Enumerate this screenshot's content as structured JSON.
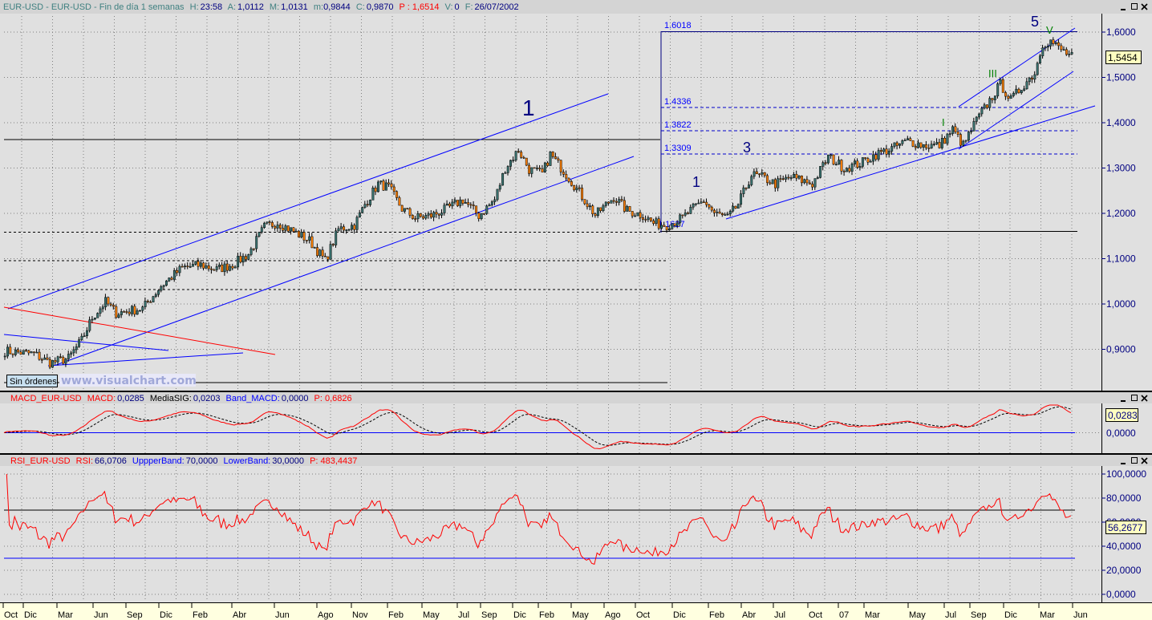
{
  "main_header": {
    "symbol": "EUR-USD - EUR-USD - Fin de día 1 semanas",
    "h_label": "H:",
    "h": "23:58",
    "a_label": "A:",
    "a": "1,0112",
    "m_label": "M:",
    "m": "1,0131",
    "min_label": "m:",
    "min": "0,9844",
    "c_label": "C:",
    "c": "0,9870",
    "p": "P : 1,6514",
    "v_label": "V:",
    "v": "0",
    "f_label": "F:",
    "f": "26/07/2002"
  },
  "macd_header": {
    "name": "MACD_EUR-USD",
    "macd_label": "MACD:",
    "macd": "0,0285",
    "sig_label": "MediaSIG:",
    "sig": "0,0203",
    "band_label": "Band_MACD:",
    "band": "0,0000",
    "p": "P: 0,6826"
  },
  "rsi_header": {
    "name": "RSI_EUR-USD",
    "rsi_label": "RSI:",
    "rsi": "66,0706",
    "upper_label": "UppperBand:",
    "upper": "70,0000",
    "lower_label": "LowerBand:",
    "lower": "30,0000",
    "p": "P: 483,4437"
  },
  "price_axis": [
    "1,6000",
    "1,5000",
    "1,4000",
    "1,3000",
    "1,2000",
    "1,1000",
    "1,0000",
    "0,9000"
  ],
  "last_price": "1,5454",
  "macd_axis": [
    "0,0000"
  ],
  "macd_last": "0,0283",
  "rsi_axis": [
    "100,0000",
    "80,0000",
    "60,0000",
    "40,0000",
    "20,0000",
    "0,0000"
  ],
  "rsi_last": "56,2677",
  "date_labels": [
    "Oct",
    "Dic",
    "Mar",
    "Jun",
    "Sep",
    "Dic",
    "Feb",
    "Abr",
    "Jun",
    "Ago",
    "Nov",
    "Feb",
    "May",
    "Jul",
    "Sep",
    "Dic",
    "Feb",
    "May",
    "Ago",
    "Oct",
    "Dic",
    "Feb",
    "Abr",
    "Jul",
    "Oct",
    "07",
    "Mar",
    "May",
    "Jul",
    "Sep",
    "Dic",
    "Mar",
    "Jun"
  ],
  "fib_levels": [
    "1.6018",
    "1.4336",
    "1.3822",
    "1.3309",
    "1.1627"
  ],
  "wave_labels": {
    "w1_big": "1",
    "w1": "1",
    "w3": "3",
    "w5": "5",
    "wI": "I",
    "wIII": "III",
    "wV": "V"
  },
  "orders_label": "Sin órdenes",
  "watermark": "www.visualchart.com",
  "colors": {
    "bull": "#3a7370",
    "bear": "#ff8000",
    "macd": "#ff0000",
    "signal": "#000000",
    "rsi": "#ff0000",
    "trend": "#0000ff"
  },
  "chart_data": {
    "type": "candlestick",
    "title": "EUR-USD weekly",
    "x_unit": "week index",
    "ylim": [
      0.85,
      1.62
    ],
    "close_anchors": [
      [
        0,
        0.896
      ],
      [
        11,
        0.89
      ],
      [
        17,
        0.87
      ],
      [
        24,
        0.88
      ],
      [
        29,
        0.92
      ],
      [
        33,
        0.97
      ],
      [
        38,
        1.005
      ],
      [
        42,
        0.98
      ],
      [
        52,
        0.99
      ],
      [
        59,
        1.04
      ],
      [
        67,
        1.08
      ],
      [
        74,
        1.086
      ],
      [
        80,
        1.076
      ],
      [
        86,
        1.087
      ],
      [
        92,
        1.11
      ],
      [
        98,
        1.17
      ],
      [
        103,
        1.18
      ],
      [
        109,
        1.16
      ],
      [
        115,
        1.14
      ],
      [
        121,
        1.095
      ],
      [
        126,
        1.165
      ],
      [
        132,
        1.174
      ],
      [
        136,
        1.22
      ],
      [
        141,
        1.265
      ],
      [
        145,
        1.257
      ],
      [
        150,
        1.21
      ],
      [
        155,
        1.19
      ],
      [
        161,
        1.195
      ],
      [
        167,
        1.21
      ],
      [
        173,
        1.23
      ],
      [
        179,
        1.195
      ],
      [
        185,
        1.23
      ],
      [
        189,
        1.3
      ],
      [
        194,
        1.34
      ],
      [
        198,
        1.297
      ],
      [
        203,
        1.287
      ],
      [
        206,
        1.33
      ],
      [
        212,
        1.287
      ],
      [
        217,
        1.246
      ],
      [
        223,
        1.196
      ],
      [
        230,
        1.236
      ],
      [
        235,
        1.206
      ],
      [
        241,
        1.196
      ],
      [
        245,
        1.178
      ],
      [
        250,
        1.174
      ],
      [
        256,
        1.19
      ],
      [
        259,
        1.206
      ],
      [
        264,
        1.228
      ],
      [
        268,
        1.2
      ],
      [
        273,
        1.19
      ],
      [
        277,
        1.22
      ],
      [
        282,
        1.285
      ],
      [
        286,
        1.28
      ],
      [
        291,
        1.265
      ],
      [
        297,
        1.28
      ],
      [
        305,
        1.265
      ],
      [
        311,
        1.325
      ],
      [
        317,
        1.3
      ],
      [
        323,
        1.31
      ],
      [
        329,
        1.33
      ],
      [
        335,
        1.343
      ],
      [
        341,
        1.36
      ],
      [
        347,
        1.35
      ],
      [
        353,
        1.35
      ],
      [
        358,
        1.385
      ],
      [
        362,
        1.35
      ],
      [
        367,
        1.406
      ],
      [
        371,
        1.44
      ],
      [
        376,
        1.485
      ],
      [
        380,
        1.45
      ],
      [
        385,
        1.485
      ],
      [
        389,
        1.51
      ],
      [
        392,
        1.575
      ],
      [
        395,
        1.58
      ],
      [
        398,
        1.565
      ],
      [
        403,
        1.545
      ]
    ],
    "macd": {
      "fast": 12,
      "slow": 26,
      "signal": 9
    },
    "rsi": {
      "period": 14,
      "upper": 70,
      "lower": 30
    }
  }
}
